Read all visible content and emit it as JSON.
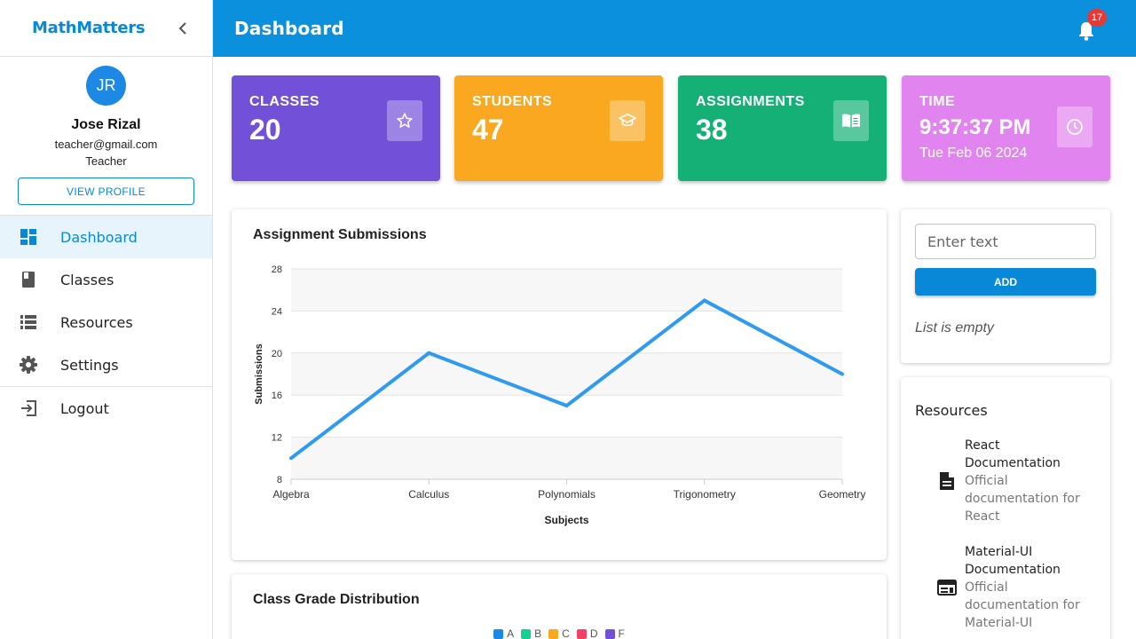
{
  "sidebar": {
    "brand": "MathMatters",
    "profile": {
      "initials": "JR",
      "name": "Jose Rizal",
      "email": "teacher@gmail.com",
      "role": "Teacher",
      "view_button": "VIEW PROFILE"
    },
    "nav": [
      {
        "label": "Dashboard",
        "icon": "dashboard-icon",
        "active": true
      },
      {
        "label": "Classes",
        "icon": "book-icon"
      },
      {
        "label": "Resources",
        "icon": "list-icon"
      },
      {
        "label": "Settings",
        "icon": "gear-icon"
      }
    ],
    "logout": {
      "label": "Logout",
      "icon": "logout-icon"
    }
  },
  "topbar": {
    "title": "Dashboard",
    "notification_count": "17"
  },
  "stats": [
    {
      "label": "CLASSES",
      "value": "20",
      "color": "#7250d8",
      "icon": "star-icon"
    },
    {
      "label": "STUDENTS",
      "value": "47",
      "color": "#f9a820",
      "icon": "graduation-cap-icon"
    },
    {
      "label": "ASSIGNMENTS",
      "value": "38",
      "color": "#14b075",
      "icon": "open-book-icon"
    },
    {
      "label": "TIME",
      "value": "9:37:37 PM",
      "date": "Tue Feb 06 2024",
      "color": "#e284f0",
      "icon": "clock-icon"
    }
  ],
  "assignment_chart": {
    "title": "Assignment Submissions"
  },
  "chart_data": [
    {
      "type": "line",
      "title": "Assignment Submissions",
      "xlabel": "Subjects",
      "ylabel": "Submissions",
      "categories": [
        "Algebra",
        "Calculus",
        "Polynomials",
        "Trigonometry",
        "Geometry"
      ],
      "series": [
        {
          "values": [
            10,
            20,
            15,
            25,
            18
          ],
          "color": "#2e9bf0"
        }
      ],
      "yticks": [
        8,
        12,
        16,
        20,
        24,
        28
      ],
      "ylim": [
        8,
        28
      ],
      "grid": true
    },
    {
      "type": "bar",
      "title": "Class Grade Distribution",
      "legend": [
        "A",
        "B",
        "C",
        "D",
        "F"
      ],
      "legend_colors": [
        "#1e88e5",
        "#14d095",
        "#f9a820",
        "#f44064",
        "#7250d8"
      ],
      "legend_position": "top"
    }
  ],
  "grade_chart": {
    "title": "Class Grade Distribution",
    "legend": [
      "A",
      "B",
      "C",
      "D",
      "F"
    ]
  },
  "todo": {
    "placeholder": "Enter text",
    "add_label": "ADD",
    "empty_text": "List is empty"
  },
  "resources": {
    "title": "Resources",
    "items": [
      {
        "name": "React Documentation",
        "desc": "Official documentation for React",
        "icon": "document-icon"
      },
      {
        "name": "Material-UI Documentation",
        "desc": "Official documentation for Material-UI",
        "icon": "web-icon"
      }
    ]
  }
}
